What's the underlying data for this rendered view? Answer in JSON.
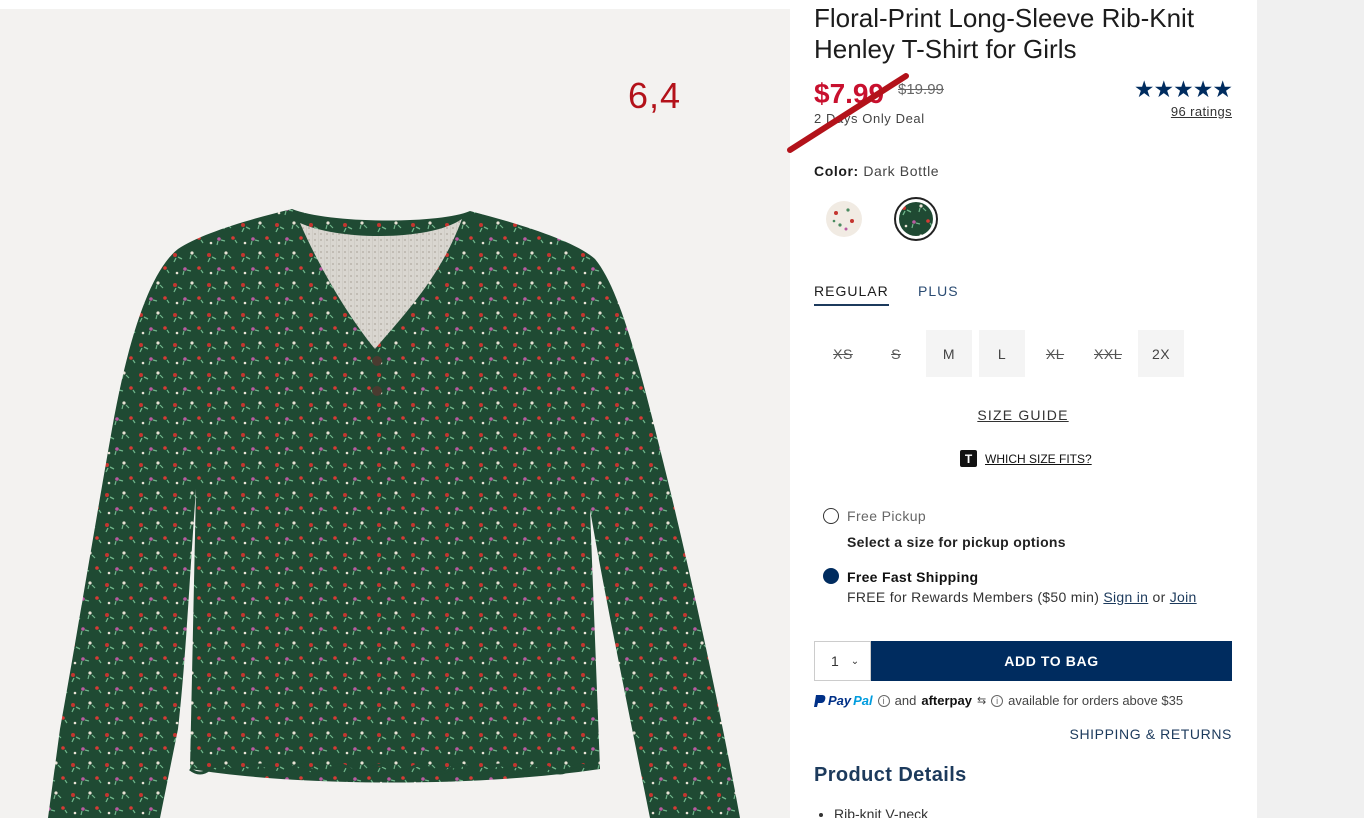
{
  "annotation": {
    "number": "6,4"
  },
  "product": {
    "title": "Floral-Print Long-Sleeve Rib-Knit Henley T-Shirt for Girls",
    "sale_price": "$7.99",
    "original_price": "$19.99",
    "deal_text": "2 Days Only Deal",
    "stars": "★★★★★",
    "rating_value": 4.7,
    "ratings_text": "96 ratings"
  },
  "color": {
    "label": "Color:",
    "selected": "Dark Bottle",
    "swatches": [
      "light floral swatch",
      "dark bottle swatch"
    ],
    "selected_index": 1
  },
  "fit_tabs": [
    {
      "label": "REGULAR",
      "active": true
    },
    {
      "label": "PLUS",
      "active": false
    }
  ],
  "sizes": [
    {
      "label": "XS",
      "available": false
    },
    {
      "label": "S",
      "available": false
    },
    {
      "label": "M",
      "available": true
    },
    {
      "label": "L",
      "available": true
    },
    {
      "label": "XL",
      "available": false
    },
    {
      "label": "XXL",
      "available": false
    },
    {
      "label": "2X",
      "available": true
    }
  ],
  "size_guide": "SIZE GUIDE",
  "which_size": {
    "badge": "T",
    "label": "WHICH SIZE FITS?"
  },
  "fulfillment": {
    "pickup_label": "Free Pickup",
    "pickup_sub": "Select a size for pickup options",
    "shipping_label": "Free Fast Shipping",
    "shipping_sub": "FREE for Rewards Members ($50 min)",
    "sign_in": "Sign in",
    "or": "or",
    "join": "Join"
  },
  "cart": {
    "quantity": "1",
    "add_button": "ADD TO BAG"
  },
  "payment": {
    "paypal_a": "Pay",
    "paypal_b": "Pal",
    "and": "and",
    "afterpay": "afterpay",
    "availability": "available for orders above $35"
  },
  "shipping_returns": "SHIPPING & RETURNS",
  "details": {
    "title": "Product Details",
    "bullets": [
      "Rib-knit V-neck"
    ]
  },
  "colors": {
    "brand_navy": "#002c5f",
    "sale_red": "#c8102e",
    "shirt_green": "#1f4a33"
  }
}
